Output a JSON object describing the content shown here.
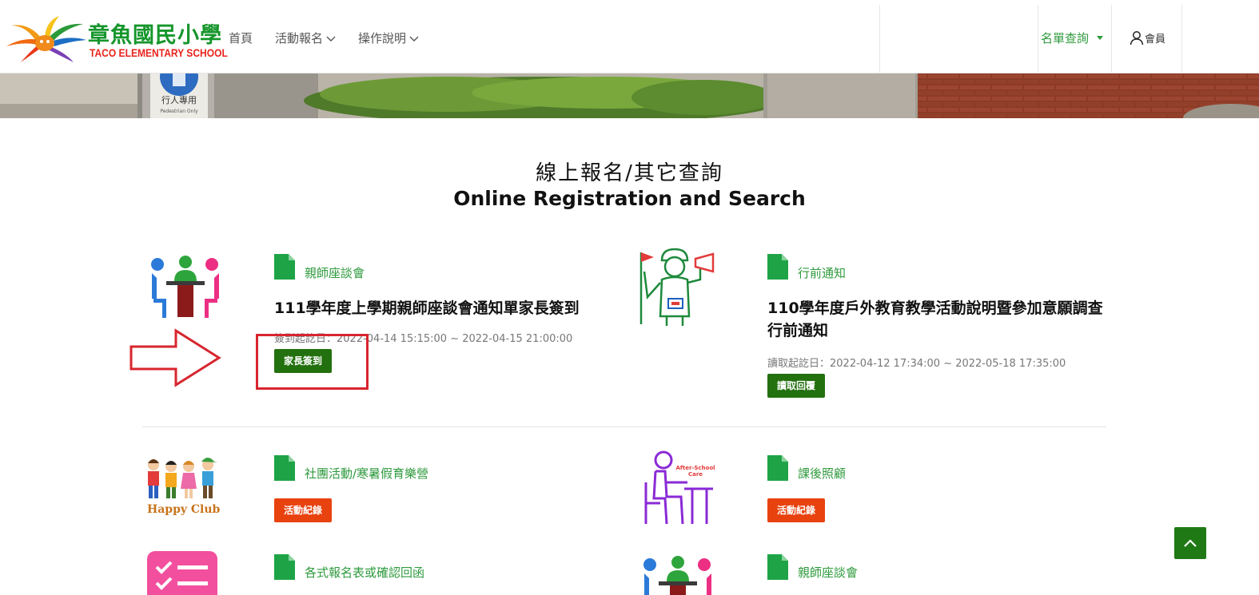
{
  "header": {
    "logo_title": "章魚國民小學",
    "logo_subtitle": "TACO ELEMENTARY SCHOOL",
    "nav": [
      {
        "label": "首頁"
      },
      {
        "label": "活動報名"
      },
      {
        "label": "操作說明"
      }
    ],
    "list_query": "名單查詢",
    "member": "會員"
  },
  "banner": {
    "sign_text": "行人專用",
    "sign_sub": "Pedestrian Only"
  },
  "section": {
    "title_zh": "線上報名/其它查詢",
    "title_en": "Online Registration and Search"
  },
  "cards": [
    {
      "category": "親師座談會",
      "title": "111學年度上學期親師座談會通知單家長簽到",
      "date": "簽到起訖日：2022-04-14 15:15:00 ~ 2022-04-15 21:00:00",
      "button": "家長簽到"
    },
    {
      "category": "行前通知",
      "title": "110學年度戶外教育教學活動說明暨參加意願調查行前通知",
      "date": "讀取起訖日：2022-04-12 17:34:00 ~ 2022-05-18 17:35:00",
      "button": "讀取回覆"
    },
    {
      "category": "社團活動/寒暑假育樂營",
      "button": "活動紀錄",
      "icon_caption": "Happy Club"
    },
    {
      "category": "課後照顧",
      "button": "活動紀錄",
      "icon_caption": "After-School Care"
    },
    {
      "category": "各式報名表或確認回函"
    },
    {
      "category": "親師座談會"
    }
  ],
  "colors": {
    "accent_green": "#2e9a3d",
    "button_green": "#23700f",
    "button_orange": "#e8420f",
    "annotation_red": "#d8252e"
  }
}
